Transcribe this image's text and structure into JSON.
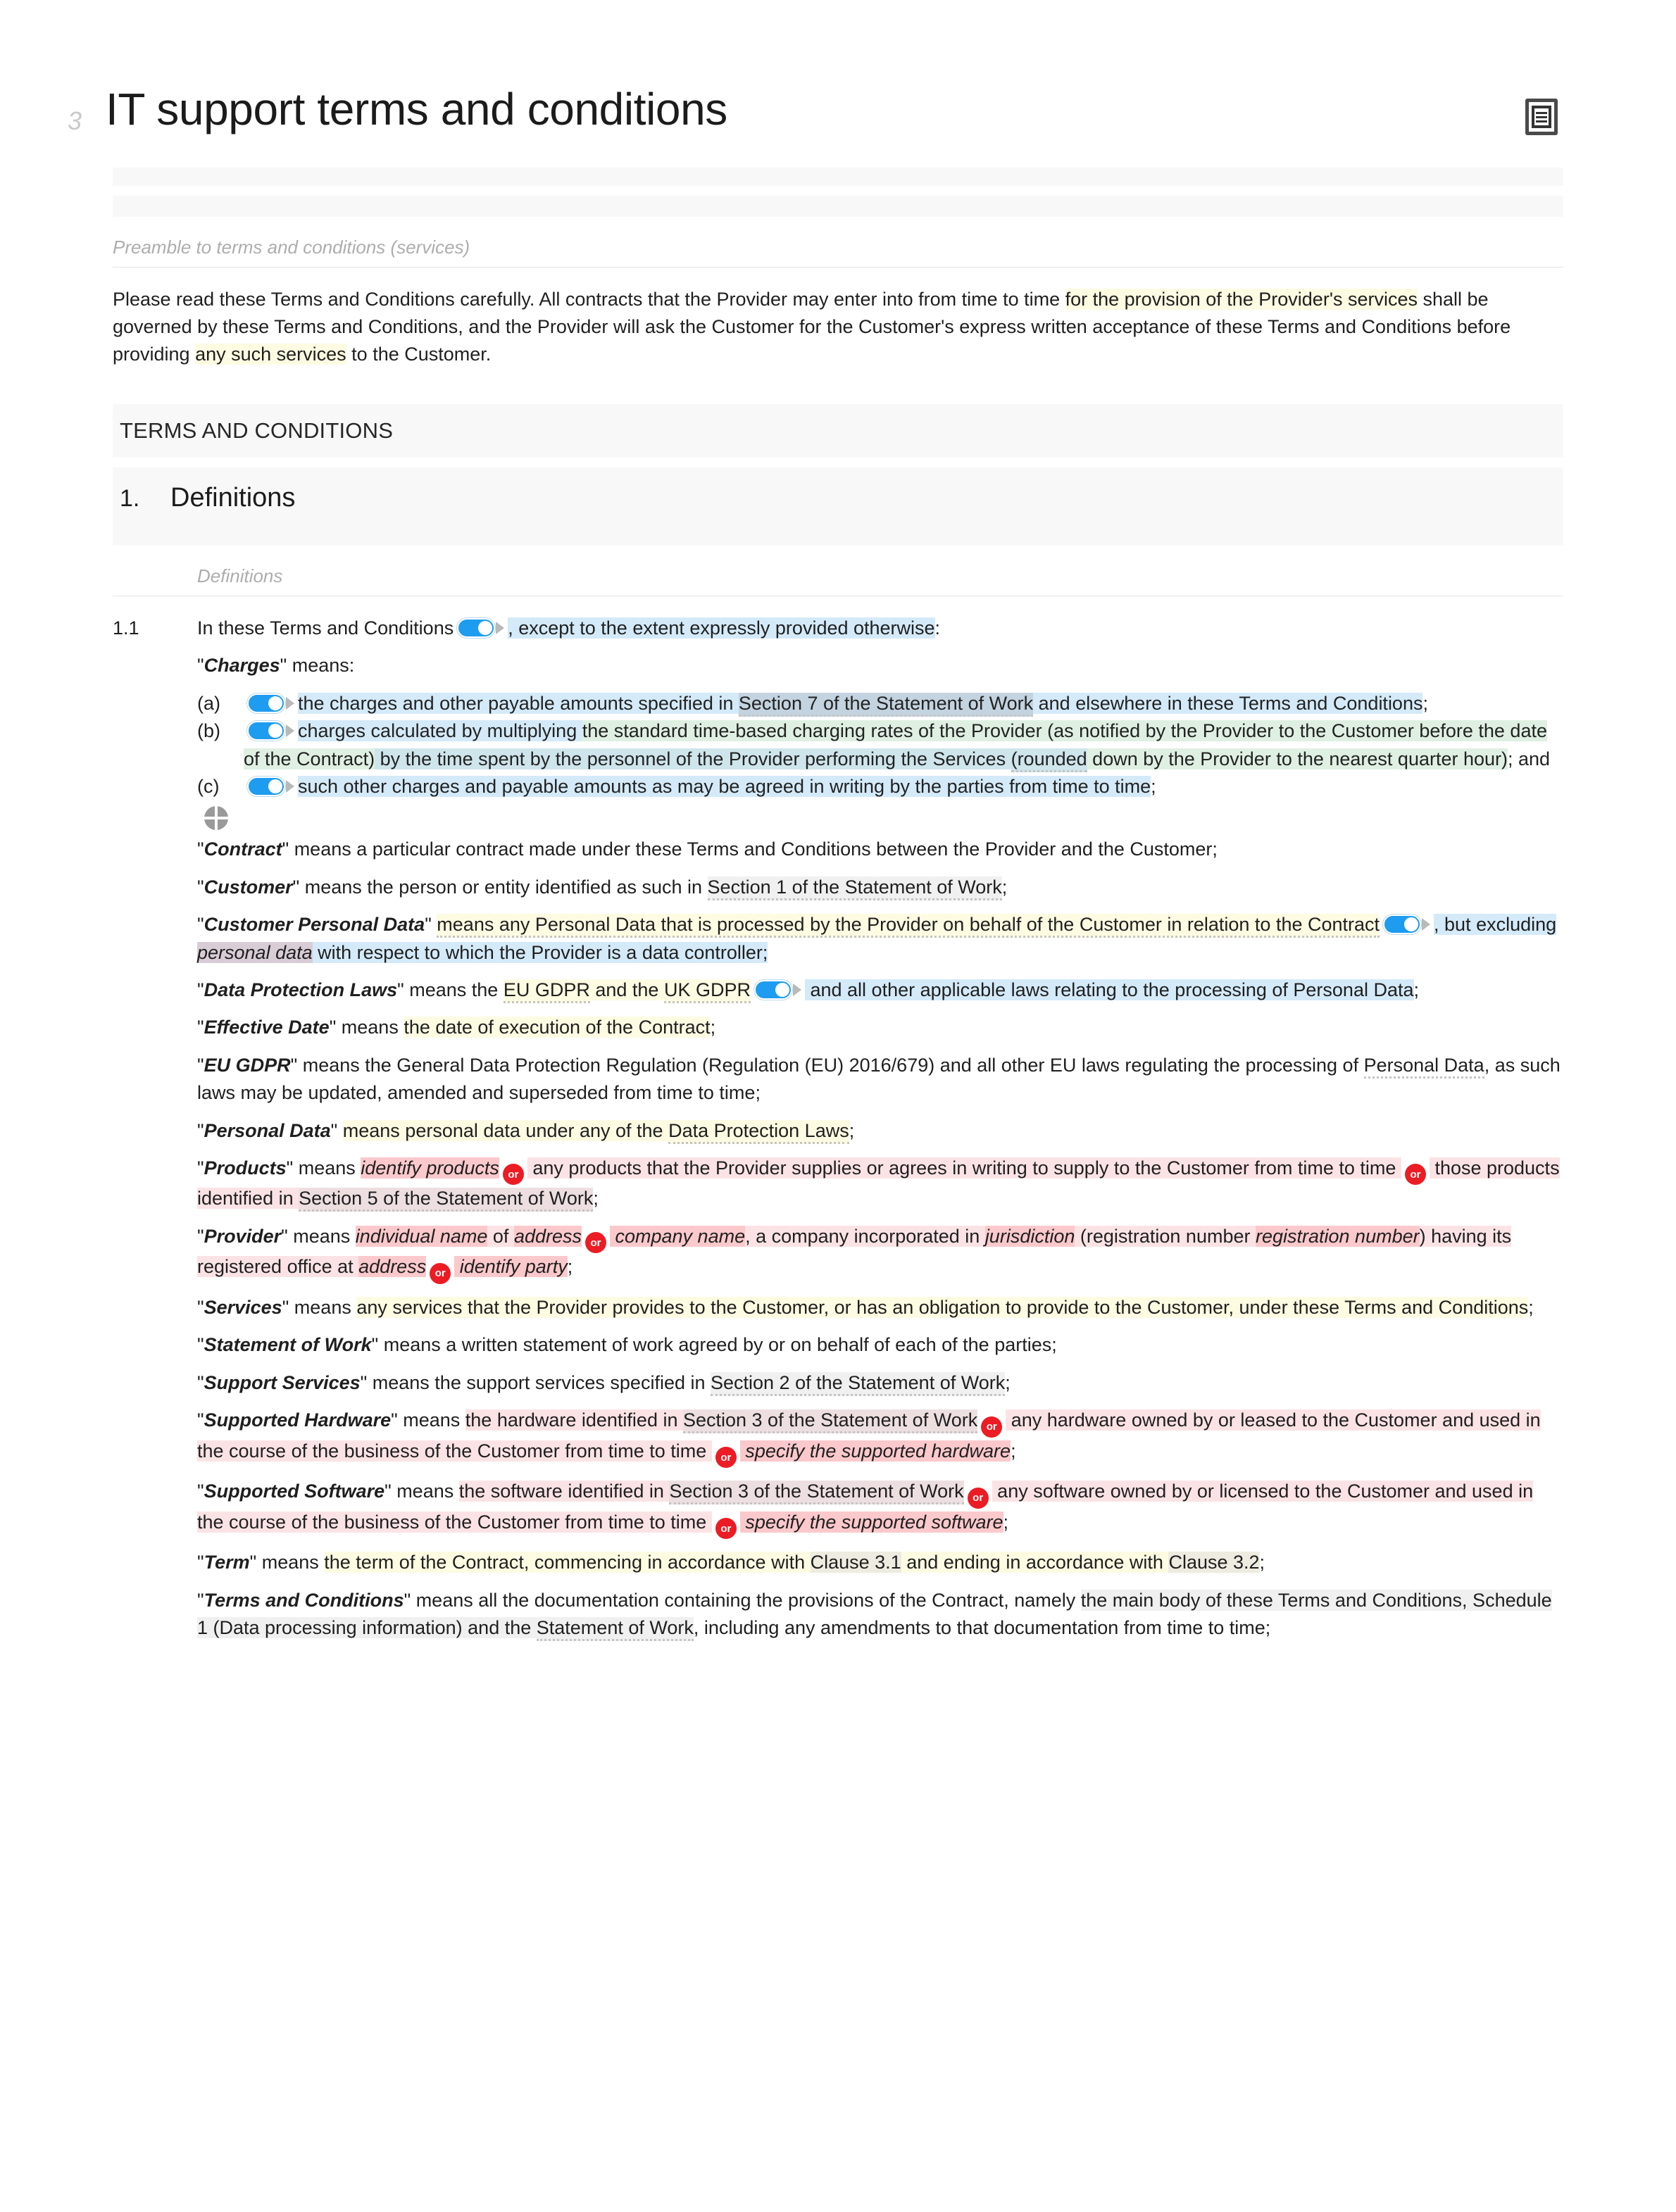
{
  "document": {
    "marker": "3",
    "title": "IT support terms and conditions",
    "title_icon": "document-list-icon"
  },
  "preamble": {
    "label": "Preamble to terms and conditions (services)",
    "text_parts": {
      "p1": "Please read these Terms and Conditions carefully. All contracts that the Provider may enter into from time to time ",
      "p2_hl": "for the provision of the Provider's services",
      "p3": " shall be governed by these Terms and Conditions, and the Provider will ask the Customer for the Customer's express written acceptance of these Terms and Conditions before providing ",
      "p4_hl": "any such services",
      "p5": " to the Customer."
    }
  },
  "terms_header": "TERMS AND CONDITIONS",
  "clause1": {
    "number": "1.",
    "name": "Definitions",
    "meta_label": "Definitions"
  },
  "clause_1_1": {
    "number": "1.1",
    "lead_a": "In these Terms and Conditions",
    "lead_b": ", except to the extent expressly provided otherwise",
    "lead_c": ":",
    "charges_term": "Charges",
    "charges_means": "\" means:",
    "items": [
      {
        "label": "(a)",
        "t1": "the charges and other payable amounts specified in ",
        "t2": "Section 7 of the Statement of Work",
        "t3": " and elsewhere in these Terms and Conditions",
        "t4": ";"
      },
      {
        "label": "(b)",
        "t1": "charges calculated by multiplying ",
        "t2": "the standard time-based charging rates of the Provider (as notified by the Provider to the Customer before the date of the Contract)",
        "t3": " by the time spent by the personnel of the Provider performing the Services ",
        "t4": "(rounded",
        "t5": " down by the Provider to the nearest quarter hour)",
        "t6": "; and"
      },
      {
        "label": "(c)",
        "t1": "such other charges and payable amounts as may be agreed in writing by the parties from time to time",
        "t2": ";"
      }
    ],
    "add_handle_icon": "add-block-handle-icon"
  },
  "definitions": [
    {
      "term": "Contract",
      "parts": [
        {
          "text": "\" means a particular contract made under these Terms and Conditions between the Provider and the Customer;",
          "style": "plain"
        }
      ]
    },
    {
      "term": "Customer",
      "parts": [
        {
          "text": "\" means the person or entity identified as such in ",
          "style": "plain"
        },
        {
          "text": "Section 1 of the Statement of Work",
          "style": "grey-dotted"
        },
        {
          "text": ";",
          "style": "plain"
        }
      ]
    },
    {
      "term": "Customer Personal Data",
      "parts": [
        {
          "text": "\" ",
          "style": "plain"
        },
        {
          "text": "means any Personal Data that is processed by the Provider on behalf of the Customer in relation to the Contract",
          "style": "yellow-dotted"
        },
        {
          "text": "TOGGLE",
          "style": "toggle"
        },
        {
          "text": ", but excluding ",
          "style": "blue"
        },
        {
          "text": "personal data",
          "style": "mauve-italic"
        },
        {
          "text": " with respect to which the Provider is a data controller;",
          "style": "blue"
        }
      ]
    },
    {
      "term": "Data Protection Laws",
      "parts": [
        {
          "text": "\" means the ",
          "style": "plain"
        },
        {
          "text": "EU GDPR",
          "style": "yellow-dotted"
        },
        {
          "text": " and the ",
          "style": "yellow"
        },
        {
          "text": "UK GDPR",
          "style": "yellow-dotted"
        },
        {
          "text": "TOGGLE",
          "style": "toggle"
        },
        {
          "text": " and all other applicable laws relating to the processing of Personal Data",
          "style": "blue"
        },
        {
          "text": ";",
          "style": "plain"
        }
      ]
    },
    {
      "term": "Effective Date",
      "parts": [
        {
          "text": "\" means ",
          "style": "plain"
        },
        {
          "text": "the date of execution of the Contract",
          "style": "yellow"
        },
        {
          "text": ";",
          "style": "plain"
        }
      ]
    },
    {
      "term": "EU GDPR",
      "parts": [
        {
          "text": "\" means the General Data Protection Regulation (Regulation (EU) 2016/679) and all other EU laws regulating the processing of ",
          "style": "plain"
        },
        {
          "text": "Personal Data",
          "style": "dotted-only"
        },
        {
          "text": ", as such laws may be updated, amended and superseded from time to time;",
          "style": "plain"
        }
      ]
    },
    {
      "term": "Personal Data",
      "parts": [
        {
          "text": "\" ",
          "style": "plain"
        },
        {
          "text": "means personal data under any of the ",
          "style": "yellow"
        },
        {
          "text": "Data Protection Laws",
          "style": "yellow-dotted"
        },
        {
          "text": ";",
          "style": "plain"
        }
      ]
    },
    {
      "term": "Products",
      "parts": [
        {
          "text": "\" means ",
          "style": "plain"
        },
        {
          "text": "identify products",
          "style": "pinkdk-italic"
        },
        {
          "text": "OR",
          "style": "orbadge"
        },
        {
          "text": " any products that the Provider supplies or agrees in writing to supply to the Customer from time to time ",
          "style": "pink"
        },
        {
          "text": "OR",
          "style": "orbadge"
        },
        {
          "text": " those products identified in ",
          "style": "pink"
        },
        {
          "text": "Section 5 of the Statement of Work",
          "style": "pinkgrey-dotted"
        },
        {
          "text": ";",
          "style": "plain"
        }
      ]
    },
    {
      "term": "Provider",
      "parts": [
        {
          "text": "\" means ",
          "style": "plain"
        },
        {
          "text": "individual name",
          "style": "pinkdk-italic"
        },
        {
          "text": " of ",
          "style": "pink"
        },
        {
          "text": "address",
          "style": "pinkdk-italic"
        },
        {
          "text": "OR",
          "style": "orbadge"
        },
        {
          "text": " company name",
          "style": "pinkdk-italic"
        },
        {
          "text": ", a company incorporated in ",
          "style": "pink"
        },
        {
          "text": "jurisdiction",
          "style": "pinkdk-italic"
        },
        {
          "text": " (registration number ",
          "style": "pink"
        },
        {
          "text": "registration number",
          "style": "pinkdk-italic"
        },
        {
          "text": ") having its registered office at ",
          "style": "pink"
        },
        {
          "text": "address",
          "style": "pinkdk-italic"
        },
        {
          "text": "OR",
          "style": "orbadge"
        },
        {
          "text": " identify party",
          "style": "pinkdk-italic"
        },
        {
          "text": ";",
          "style": "plain"
        }
      ]
    },
    {
      "term": "Services",
      "parts": [
        {
          "text": "\" means ",
          "style": "plain"
        },
        {
          "text": "any services that the Provider provides to the Customer, or has an obligation to provide to the Customer, under these Terms and Conditions",
          "style": "yellow"
        },
        {
          "text": ";",
          "style": "plain"
        }
      ]
    },
    {
      "term": "Statement of Work",
      "parts": [
        {
          "text": "\" means a written statement of work agreed by or on behalf of each of the parties;",
          "style": "plain"
        }
      ]
    },
    {
      "term": "Support Services",
      "parts": [
        {
          "text": "\" means the support services specified in ",
          "style": "plain"
        },
        {
          "text": "Section 2 of the Statement of Work",
          "style": "grey-dotted"
        },
        {
          "text": ";",
          "style": "plain"
        }
      ]
    },
    {
      "term": "Supported Hardware",
      "parts": [
        {
          "text": "\" means ",
          "style": "plain"
        },
        {
          "text": "the hardware identified in ",
          "style": "pink"
        },
        {
          "text": "Section 3 of the Statement of Work",
          "style": "pinkgrey-dotted"
        },
        {
          "text": "OR",
          "style": "orbadge"
        },
        {
          "text": " any hardware owned by or leased to the Customer and used in the course of the business of the Customer from time to time ",
          "style": "pink"
        },
        {
          "text": "OR",
          "style": "orbadge"
        },
        {
          "text": " specify the supported hardware",
          "style": "pinkdk-italic"
        },
        {
          "text": ";",
          "style": "plain"
        }
      ]
    },
    {
      "term": "Supported Software",
      "parts": [
        {
          "text": "\" means ",
          "style": "plain"
        },
        {
          "text": "the software identified in ",
          "style": "pink"
        },
        {
          "text": "Section 3 of the Statement of Work",
          "style": "pinkgrey-dotted"
        },
        {
          "text": "OR",
          "style": "orbadge"
        },
        {
          "text": " any software owned by or licensed to the Customer and used in the course of the business of the Customer from time to time ",
          "style": "pink"
        },
        {
          "text": "OR",
          "style": "orbadge"
        },
        {
          "text": " specify the supported software",
          "style": "pinkdk-italic"
        },
        {
          "text": ";",
          "style": "plain"
        }
      ]
    },
    {
      "term": "Term",
      "parts": [
        {
          "text": "\" means ",
          "style": "plain"
        },
        {
          "text": "the term of the Contract, commencing in accordance with ",
          "style": "yellow"
        },
        {
          "text": "Clause 3.1",
          "style": "greybeige"
        },
        {
          "text": " and ending in accordance with ",
          "style": "yellow"
        },
        {
          "text": "Clause 3.2",
          "style": "greybeige"
        },
        {
          "text": ";",
          "style": "plain"
        }
      ]
    },
    {
      "term": "Terms and Conditions",
      "parts": [
        {
          "text": "\" means all the documentation containing the provisions of the Contract, namely ",
          "style": "plain"
        },
        {
          "text": "the main body of these Terms and Conditions, Schedule 1 (Data processing information) and the ",
          "style": "grey"
        },
        {
          "text": "Statement of Work",
          "style": "grey-dotted"
        },
        {
          "text": ", including any amendments to that documentation from time to time;",
          "style": "plain"
        }
      ]
    }
  ]
}
